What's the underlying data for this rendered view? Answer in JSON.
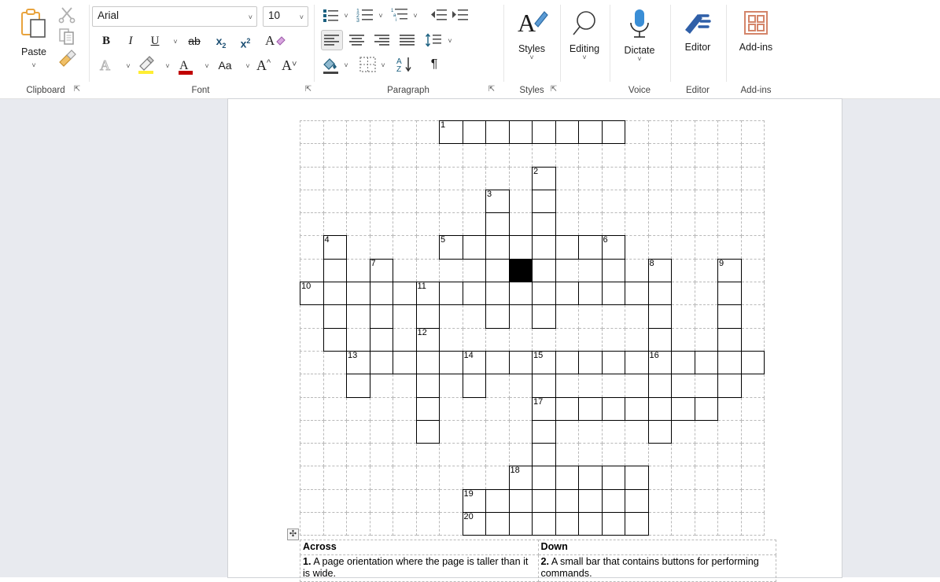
{
  "ribbon": {
    "groups": [
      {
        "id": "clipboard",
        "label": "Clipboard"
      },
      {
        "id": "font",
        "label": "Font"
      },
      {
        "id": "paragraph",
        "label": "Paragraph"
      },
      {
        "id": "styles",
        "label": "Styles"
      },
      {
        "id": "editing",
        "label": ""
      },
      {
        "id": "voice",
        "label": "Voice"
      },
      {
        "id": "editor",
        "label": "Editor"
      },
      {
        "id": "addins",
        "label": "Add-ins"
      }
    ],
    "clipboard": {
      "paste_label": "Paste",
      "cut_icon": "scissors-icon",
      "copy_icon": "copy-icon",
      "format_painter_icon": "format-painter-icon",
      "group_label": "Clipboard"
    },
    "font": {
      "font_name": "Arial",
      "font_size": "10",
      "bold_label": "B",
      "italic_label": "I",
      "underline_label": "U",
      "strikethrough_label": "ab",
      "subscript_label": "x",
      "subscript_sub": "2",
      "superscript_label": "x",
      "superscript_sup": "2",
      "clear_formatting_icon": "clear-formatting-icon",
      "text_effects_icon": "text-effects-icon",
      "highlight_icon": "text-highlight-icon",
      "font_color_label": "A",
      "change_case_label": "Aa",
      "grow_font_label": "A",
      "shrink_font_label": "A",
      "group_label": "Font"
    },
    "paragraph": {
      "bullets_icon": "bullet-list-icon",
      "numbering_icon": "numbered-list-icon",
      "multilevel_icon": "multilevel-list-icon",
      "decrease_indent_icon": "decrease-indent-icon",
      "increase_indent_icon": "increase-indent-icon",
      "align_left_icon": "align-left-icon",
      "align_center_icon": "align-center-icon",
      "align_right_icon": "align-right-icon",
      "justify_icon": "justify-icon",
      "line_spacing_icon": "line-spacing-icon",
      "shading_icon": "shading-icon",
      "borders_icon": "borders-icon",
      "sort_icon": "sort-icon",
      "show_marks_label": "¶",
      "group_label": "Paragraph"
    },
    "styles": {
      "label": "Styles",
      "group_label": "Styles"
    },
    "editing": {
      "label": "Editing"
    },
    "voice": {
      "label": "Dictate",
      "group_label": "Voice"
    },
    "editor": {
      "label": "Editor",
      "group_label": "Editor"
    },
    "addins": {
      "label": "Add-ins",
      "group_label": "Add-ins"
    }
  },
  "document": {
    "table_handle_icon": "table-move-handle-icon",
    "crossword": {
      "rows": 18,
      "cols": 20,
      "cell_size": 29.5,
      "black_cells": [
        {
          "r": 6,
          "c": 9
        }
      ],
      "numbered_cells": [
        {
          "n": "1",
          "r": 0,
          "c": 6
        },
        {
          "n": "2",
          "r": 2,
          "c": 10
        },
        {
          "n": "3",
          "r": 3,
          "c": 8
        },
        {
          "n": "4",
          "r": 5,
          "c": 1
        },
        {
          "n": "5",
          "r": 5,
          "c": 6
        },
        {
          "n": "6",
          "r": 5,
          "c": 13
        },
        {
          "n": "7",
          "r": 6,
          "c": 3
        },
        {
          "n": "8",
          "r": 6,
          "c": 15
        },
        {
          "n": "9",
          "r": 6,
          "c": 18
        },
        {
          "n": "10",
          "r": 7,
          "c": 0
        },
        {
          "n": "11",
          "r": 7,
          "c": 5
        },
        {
          "n": "12",
          "r": 9,
          "c": 5
        },
        {
          "n": "13",
          "r": 10,
          "c": 2
        },
        {
          "n": "14",
          "r": 10,
          "c": 7
        },
        {
          "n": "15",
          "r": 10,
          "c": 10
        },
        {
          "n": "16",
          "r": 10,
          "c": 15
        },
        {
          "n": "17",
          "r": 12,
          "c": 10
        },
        {
          "n": "18",
          "r": 15,
          "c": 9
        },
        {
          "n": "19",
          "r": 16,
          "c": 7
        },
        {
          "n": "20",
          "r": 17,
          "c": 7
        }
      ],
      "filled_cells": [
        {
          "r": 0,
          "c": 6
        },
        {
          "r": 0,
          "c": 7
        },
        {
          "r": 0,
          "c": 8
        },
        {
          "r": 0,
          "c": 9
        },
        {
          "r": 0,
          "c": 10
        },
        {
          "r": 0,
          "c": 11
        },
        {
          "r": 0,
          "c": 12
        },
        {
          "r": 0,
          "c": 13
        },
        {
          "r": 2,
          "c": 10
        },
        {
          "r": 3,
          "c": 10
        },
        {
          "r": 4,
          "c": 10
        },
        {
          "r": 3,
          "c": 8
        },
        {
          "r": 4,
          "c": 8
        },
        {
          "r": 5,
          "c": 1
        },
        {
          "r": 6,
          "c": 1
        },
        {
          "r": 7,
          "c": 1
        },
        {
          "r": 8,
          "c": 1
        },
        {
          "r": 9,
          "c": 1
        },
        {
          "r": 5,
          "c": 6
        },
        {
          "r": 5,
          "c": 7
        },
        {
          "r": 5,
          "c": 8
        },
        {
          "r": 5,
          "c": 9
        },
        {
          "r": 5,
          "c": 10
        },
        {
          "r": 5,
          "c": 11
        },
        {
          "r": 5,
          "c": 12
        },
        {
          "r": 5,
          "c": 13
        },
        {
          "r": 6,
          "c": 3
        },
        {
          "r": 7,
          "c": 3
        },
        {
          "r": 8,
          "c": 3
        },
        {
          "r": 9,
          "c": 3
        },
        {
          "r": 10,
          "c": 3
        },
        {
          "r": 6,
          "c": 8
        },
        {
          "r": 6,
          "c": 10
        },
        {
          "r": 6,
          "c": 13
        },
        {
          "r": 6,
          "c": 15
        },
        {
          "r": 7,
          "c": 15
        },
        {
          "r": 8,
          "c": 15
        },
        {
          "r": 9,
          "c": 15
        },
        {
          "r": 6,
          "c": 18
        },
        {
          "r": 7,
          "c": 18
        },
        {
          "r": 8,
          "c": 18
        },
        {
          "r": 9,
          "c": 18
        },
        {
          "r": 7,
          "c": 0
        },
        {
          "r": 7,
          "c": 2
        },
        {
          "r": 7,
          "c": 4
        },
        {
          "r": 7,
          "c": 5
        },
        {
          "r": 7,
          "c": 6
        },
        {
          "r": 7,
          "c": 7
        },
        {
          "r": 7,
          "c": 8
        },
        {
          "r": 7,
          "c": 9
        },
        {
          "r": 7,
          "c": 10
        },
        {
          "r": 7,
          "c": 11
        },
        {
          "r": 7,
          "c": 12
        },
        {
          "r": 7,
          "c": 13
        },
        {
          "r": 7,
          "c": 14
        },
        {
          "r": 8,
          "c": 5
        },
        {
          "r": 9,
          "c": 5
        },
        {
          "r": 10,
          "c": 5
        },
        {
          "r": 11,
          "c": 5
        },
        {
          "r": 12,
          "c": 5
        },
        {
          "r": 13,
          "c": 5
        },
        {
          "r": 8,
          "c": 8
        },
        {
          "r": 8,
          "c": 10
        },
        {
          "r": 10,
          "c": 2
        },
        {
          "r": 10,
          "c": 4
        },
        {
          "r": 10,
          "c": 6
        },
        {
          "r": 10,
          "c": 7
        },
        {
          "r": 10,
          "c": 8
        },
        {
          "r": 10,
          "c": 9
        },
        {
          "r": 10,
          "c": 10
        },
        {
          "r": 10,
          "c": 11
        },
        {
          "r": 10,
          "c": 12
        },
        {
          "r": 10,
          "c": 13
        },
        {
          "r": 10,
          "c": 14
        },
        {
          "r": 10,
          "c": 15
        },
        {
          "r": 10,
          "c": 16
        },
        {
          "r": 10,
          "c": 17
        },
        {
          "r": 10,
          "c": 18
        },
        {
          "r": 10,
          "c": 19
        },
        {
          "r": 11,
          "c": 2
        },
        {
          "r": 11,
          "c": 7
        },
        {
          "r": 11,
          "c": 10
        },
        {
          "r": 11,
          "c": 15
        },
        {
          "r": 11,
          "c": 18
        },
        {
          "r": 12,
          "c": 10
        },
        {
          "r": 12,
          "c": 11
        },
        {
          "r": 12,
          "c": 12
        },
        {
          "r": 12,
          "c": 13
        },
        {
          "r": 12,
          "c": 14
        },
        {
          "r": 12,
          "c": 15
        },
        {
          "r": 12,
          "c": 16
        },
        {
          "r": 12,
          "c": 17
        },
        {
          "r": 13,
          "c": 10
        },
        {
          "r": 13,
          "c": 15
        },
        {
          "r": 14,
          "c": 10
        },
        {
          "r": 15,
          "c": 9
        },
        {
          "r": 15,
          "c": 10
        },
        {
          "r": 15,
          "c": 11
        },
        {
          "r": 15,
          "c": 12
        },
        {
          "r": 15,
          "c": 13
        },
        {
          "r": 15,
          "c": 14
        },
        {
          "r": 16,
          "c": 7
        },
        {
          "r": 16,
          "c": 8
        },
        {
          "r": 16,
          "c": 9
        },
        {
          "r": 16,
          "c": 10
        },
        {
          "r": 16,
          "c": 11
        },
        {
          "r": 16,
          "c": 12
        },
        {
          "r": 16,
          "c": 13
        },
        {
          "r": 16,
          "c": 14
        },
        {
          "r": 17,
          "c": 7
        },
        {
          "r": 17,
          "c": 8
        },
        {
          "r": 17,
          "c": 9
        },
        {
          "r": 17,
          "c": 10
        },
        {
          "r": 17,
          "c": 11
        },
        {
          "r": 17,
          "c": 12
        },
        {
          "r": 17,
          "c": 13
        },
        {
          "r": 17,
          "c": 14
        }
      ]
    },
    "clues": {
      "across_heading": "Across",
      "down_heading": "Down",
      "across": [
        {
          "num": "1.",
          "text": " A page orientation where the page is taller than it is wide."
        }
      ],
      "down": [
        {
          "num": "2.",
          "text": " A small bar that contains buttons for performing commands."
        }
      ]
    }
  }
}
